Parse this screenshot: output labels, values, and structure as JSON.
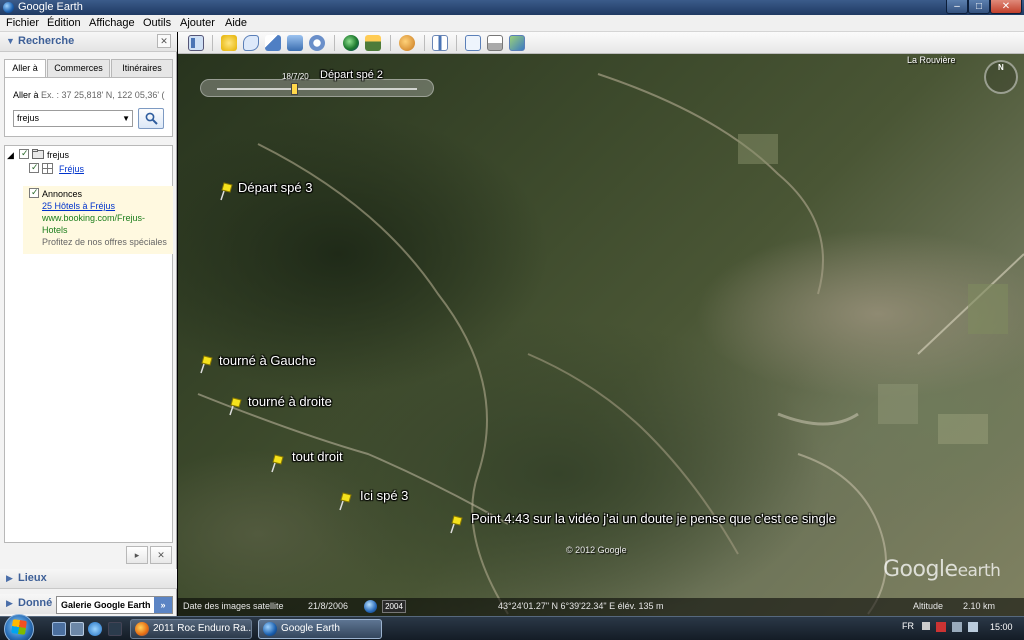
{
  "window": {
    "title": "Google Earth",
    "controls": {
      "minimize": "–",
      "maximize": "□",
      "close": "✕"
    }
  },
  "menu": [
    "Fichier",
    "Édition",
    "Affichage",
    "Outils",
    "Ajouter",
    "Aide"
  ],
  "search_panel": {
    "header": "Recherche",
    "tabs": [
      "Aller à",
      "Commerces",
      "Itinéraires"
    ],
    "goto_prefix": "Aller à",
    "goto_hint": "Ex. : 37 25,818' N, 122 05,36' (",
    "search_value": "frejus"
  },
  "places": {
    "root_label": "frejus",
    "child_label": "Fréjus",
    "ads_label": "Annonces",
    "ad_link": "25 Hôtels à Fréjus",
    "ad_url_1": "www.booking.com/Frejus-",
    "ad_url_2": "Hotels",
    "ad_text": "Profitez de nos offres spéciales"
  },
  "bottom_panels": {
    "lieux": "Lieux",
    "donnees": "Donné",
    "galerie": "Galerie Google Earth",
    "galerie_btn": "»"
  },
  "map": {
    "date_label": "18/7/20",
    "top_pin_label": "Départ spé 2",
    "place_name": "La Rouvière",
    "placemarks": [
      {
        "label": "Départ spé 3"
      },
      {
        "label": "tourné à Gauche"
      },
      {
        "label": "tourné à droite"
      },
      {
        "label": "tout droit"
      },
      {
        "label": "Ici spé 3"
      },
      {
        "label": "Point 4:43 sur la vidéo j'ai un doute je pense que c'est ce single"
      }
    ],
    "copyright": "© 2012 Google",
    "logo_main": "Google",
    "logo_sub": "earth",
    "compass_letter": "N"
  },
  "status": {
    "imagery_label": "Date des images satellite",
    "imagery_date": "21/8/2006",
    "year": "2004",
    "coords": "43°24'01.27\" N    6°39'22.34\" E  élév.   135 m",
    "altitude_label": "Altitude",
    "altitude_value": "2.10 km"
  },
  "taskbar": {
    "tasks": [
      "2011 Roc Enduro Ra...",
      "Google Earth"
    ],
    "lang": "FR",
    "clock": "15:00"
  }
}
